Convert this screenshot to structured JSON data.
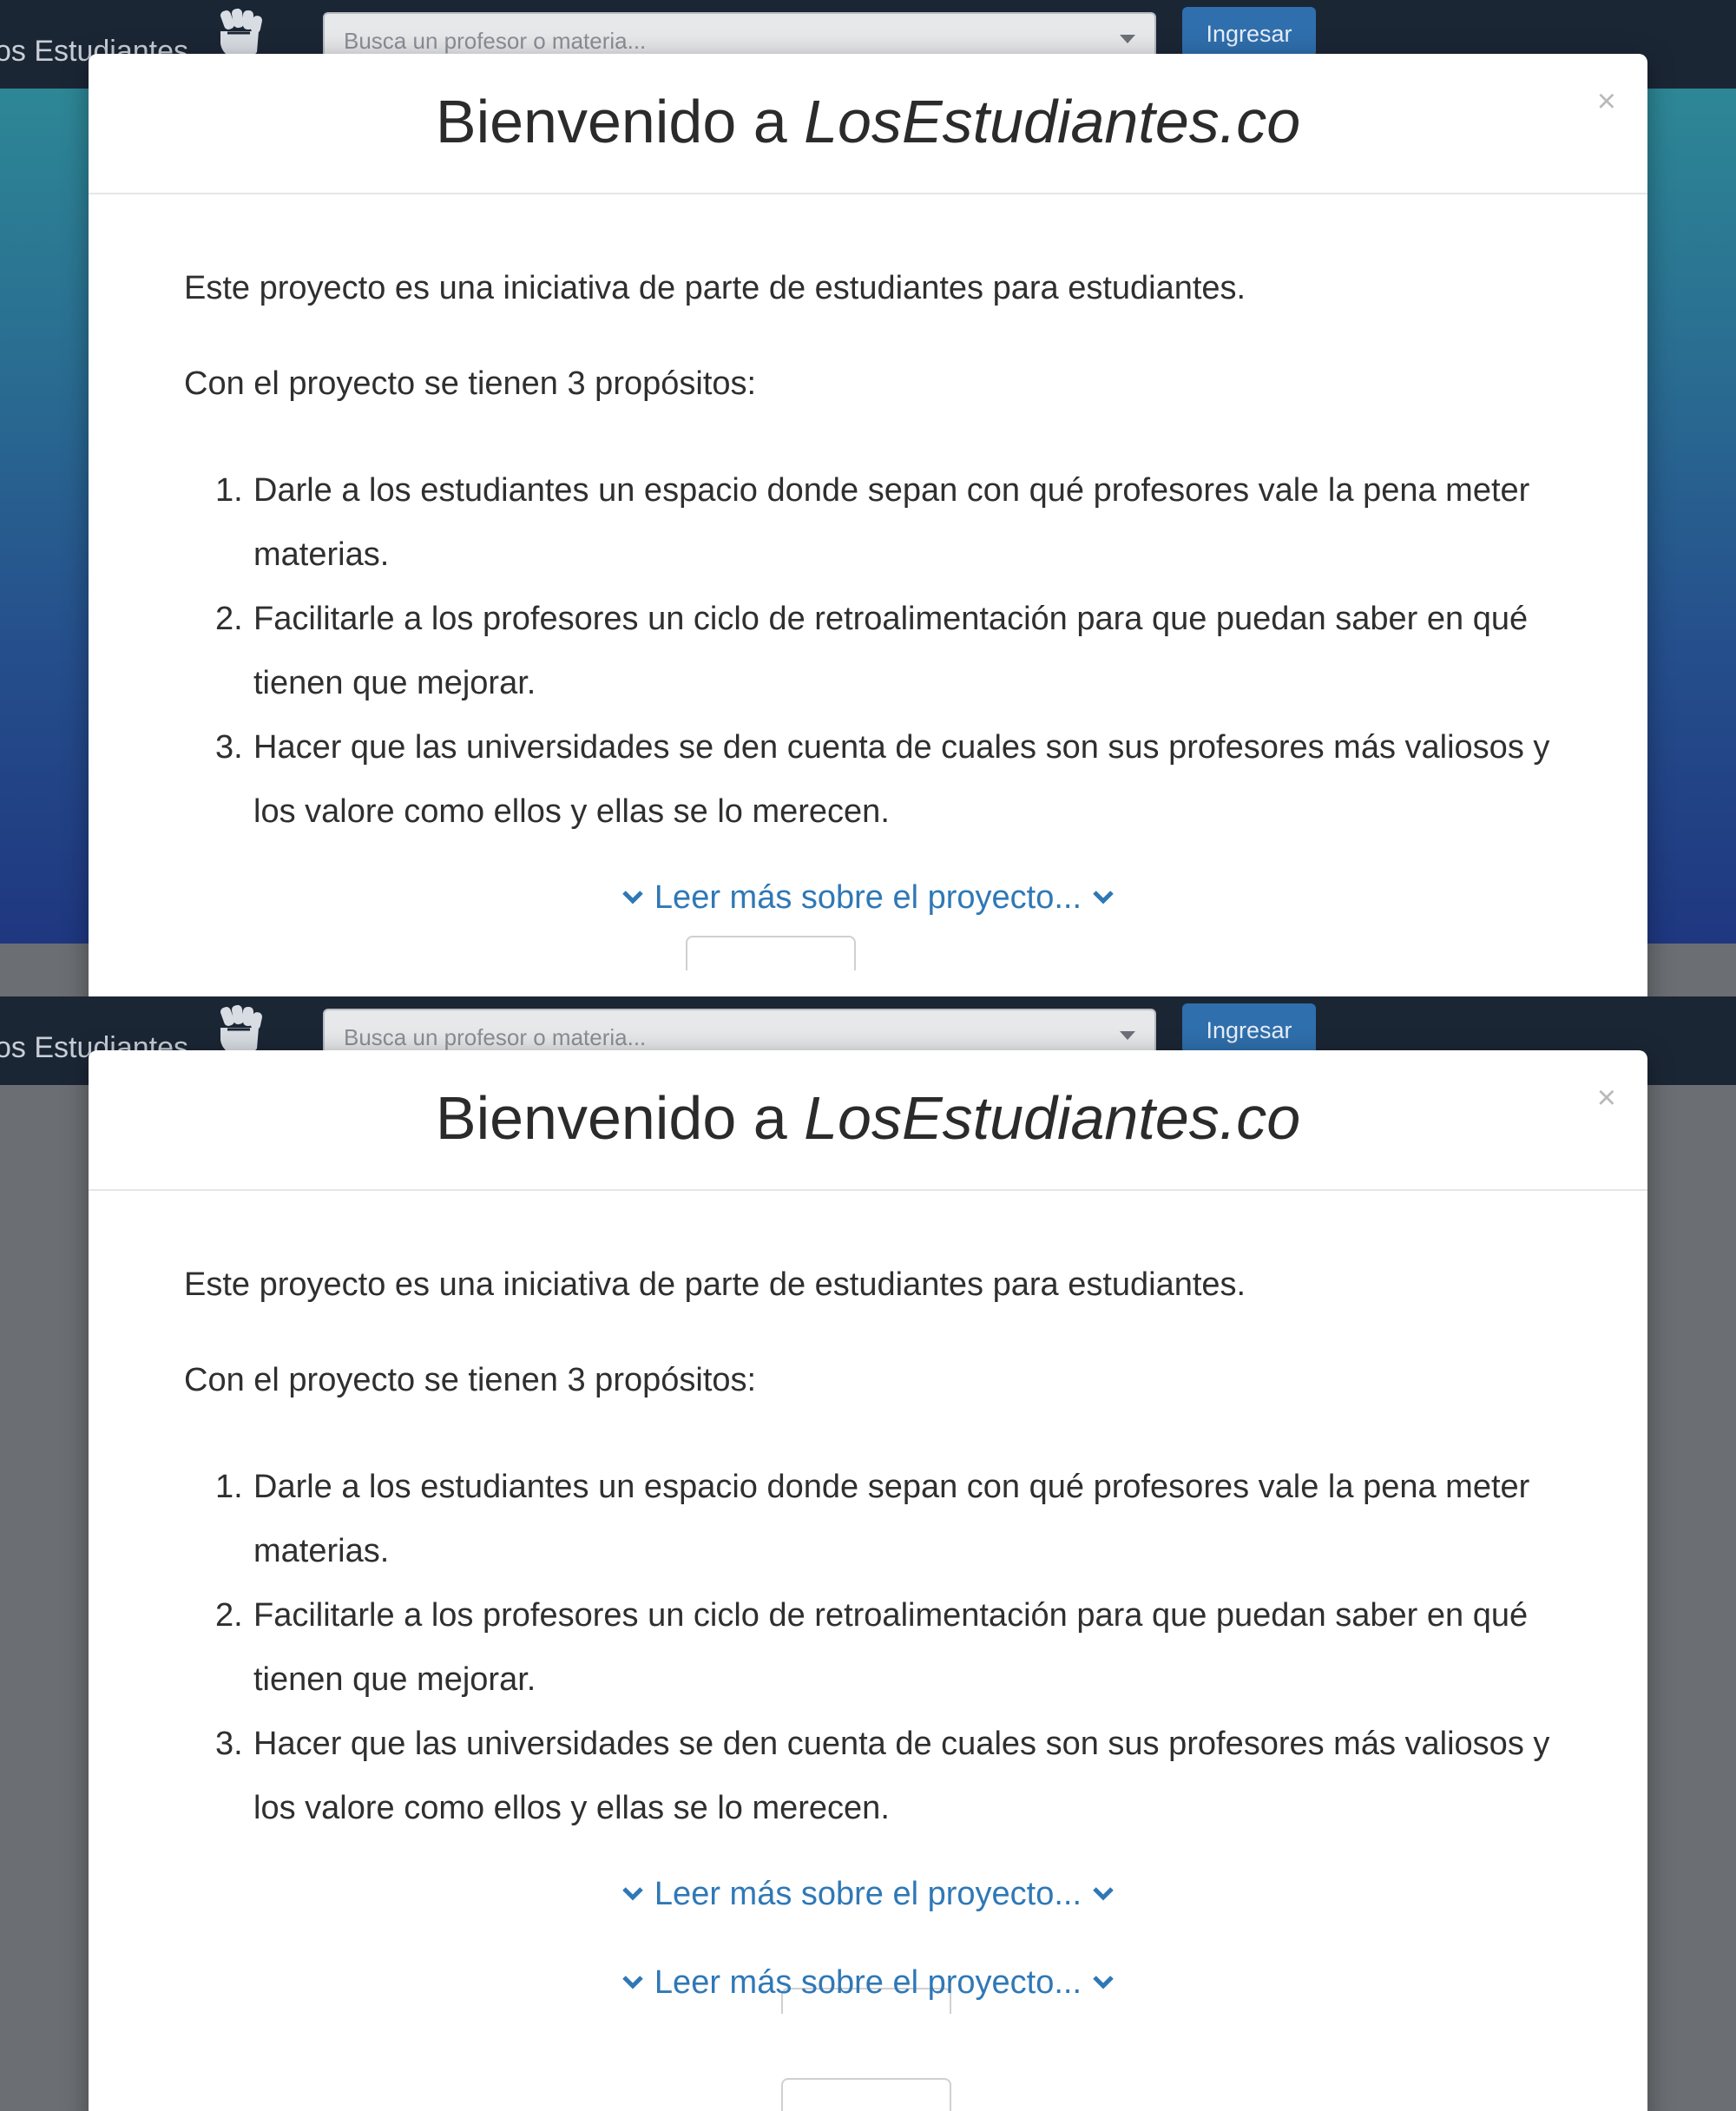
{
  "navbar": {
    "brand": "os Estudiantes",
    "logo_icon": "fist-icon",
    "search_placeholder": "Busca un profesor o materia...",
    "login_label": "Ingresar"
  },
  "modal": {
    "title_prefix": "Bienvenido a ",
    "title_site": "LosEstudiantes.co",
    "close_label": "×",
    "intro": "Este proyecto es una iniciativa de parte de estudiantes para estudiantes.",
    "subtitle": "Con el proyecto se tienen 3 propósitos:",
    "purposes": [
      {
        "num": "1.",
        "text": "Darle a los estudiantes un espacio donde sepan con qué profesores vale la pena meter materias."
      },
      {
        "num": "2.",
        "text": "Facilitarle a los profesores un ciclo de retroalimentación para que puedan saber en qué tienen que mejorar."
      },
      {
        "num": "3.",
        "text": "Hacer que las universidades se den cuenta de cuales son sus profesores más valiosos y los valore como ellos y ellas se lo merecen."
      }
    ],
    "read_more": "Leer más sobre el proyecto..."
  },
  "colors": {
    "navbar": "#1b2635",
    "accent": "#2f78b6",
    "login_button": "#2f6fad"
  }
}
